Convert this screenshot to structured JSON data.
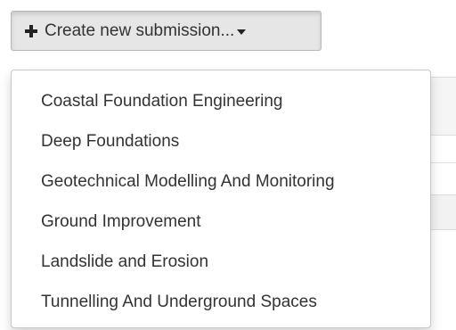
{
  "toolbar": {
    "create_button_label": "Create new submission..."
  },
  "icons": {
    "create_button_icon": "plus-icon",
    "create_button_caret": "caret-down-icon"
  },
  "dropdown": {
    "items": [
      {
        "label": "Coastal Foundation Engineering"
      },
      {
        "label": "Deep Foundations"
      },
      {
        "label": "Geotechnical Modelling And Monitoring"
      },
      {
        "label": "Ground Improvement"
      },
      {
        "label": "Landslide and Erosion"
      },
      {
        "label": "Tunnelling And Underground Spaces"
      }
    ]
  }
}
